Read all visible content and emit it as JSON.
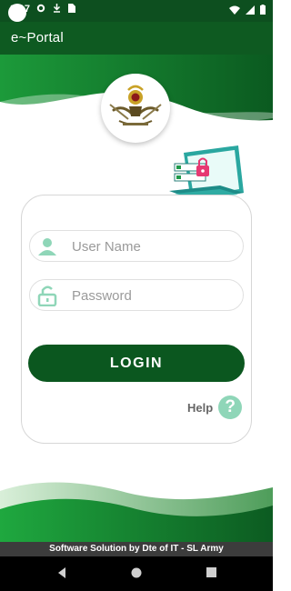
{
  "status_bar": {
    "time": "8:17",
    "icons": [
      "settings-icon",
      "download-icon",
      "sim-icon",
      "wifi-icon",
      "signal-icon",
      "battery-icon"
    ]
  },
  "app_bar": {
    "title": "e~Portal"
  },
  "login": {
    "username_placeholder": "User Name",
    "password_placeholder": "Password",
    "login_button": "LOGIN",
    "help_label": "Help",
    "help_icon_glyph": "?"
  },
  "footer": {
    "text": "Software Solution by Dte of IT - SL Army"
  },
  "colors": {
    "primary_dark": "#0b571f",
    "primary_bright": "#1fa03d",
    "help_accent": "#8fd6b8"
  }
}
